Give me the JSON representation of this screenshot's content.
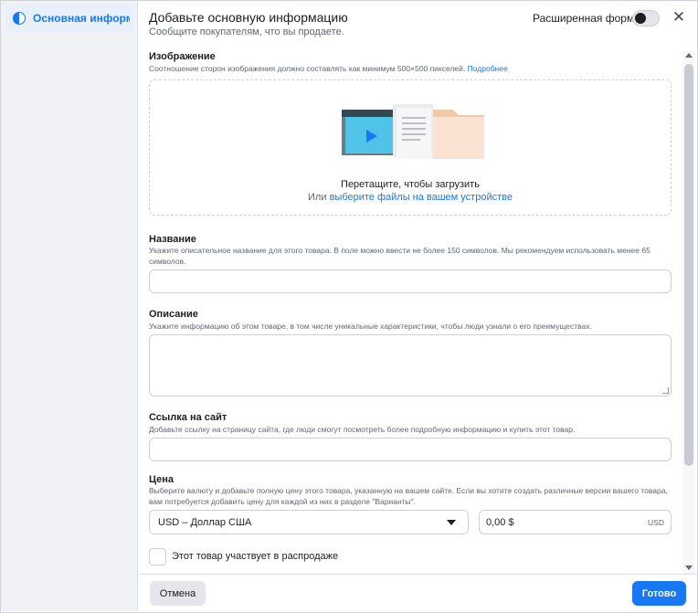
{
  "sidebar": {
    "items": [
      {
        "label": "Основная информация",
        "icon": "half-circle-icon",
        "active": true
      }
    ]
  },
  "header": {
    "title": "Добавьте основную информацию",
    "subtitle": "Сообщите покупателям, что вы продаете.",
    "advanced_form_label": "Расширенная форма",
    "advanced_form_enabled": false,
    "close_icon": "close-icon"
  },
  "image_section": {
    "title": "Изображение",
    "description": "Соотношение сторон изображения должно составлять как минимум 500×500 пикселей.",
    "more_link": "Подробнее",
    "drop_text": "Перетащите, чтобы загрузить",
    "or_text": "Или",
    "choose_link": "выберите файлы на вашем устройстве"
  },
  "name_section": {
    "title": "Название",
    "description": "Укажите описательное название для этого товара. В поле можно ввести не более 150 символов. Мы рекомендуем использовать менее 65 символов.",
    "value": ""
  },
  "description_section": {
    "title": "Описание",
    "description": "Укажите информацию об этом товаре, в том числе уникальные характеристики, чтобы люди узнали о его преимуществах.",
    "value": ""
  },
  "website_section": {
    "title": "Ссылка на сайт",
    "description": "Добавьте ссылку на страницу сайта, где люди смогут посмотреть более подробную информацию и купить этот товар.",
    "value": ""
  },
  "price_section": {
    "title": "Цена",
    "description": "Выберите валюту и добавьте полную цену этого товара, указанную на вашем сайте. Если вы хотите создать различные версии вашего товара, вам потребуется добавить цену для каждой из них в разделе \"Варианты\".",
    "currency_selected": "USD – Доллар США",
    "price_value": "0,00 $",
    "currency_code": "USD"
  },
  "sale_checkbox": {
    "label": "Этот товар участвует в распродаже",
    "checked": false
  },
  "footer": {
    "cancel_label": "Отмена",
    "done_label": "Готово"
  },
  "colors": {
    "accent": "#1877f2",
    "background": "#f0f2f5",
    "text": "#1c1e21",
    "muted": "#606770"
  }
}
